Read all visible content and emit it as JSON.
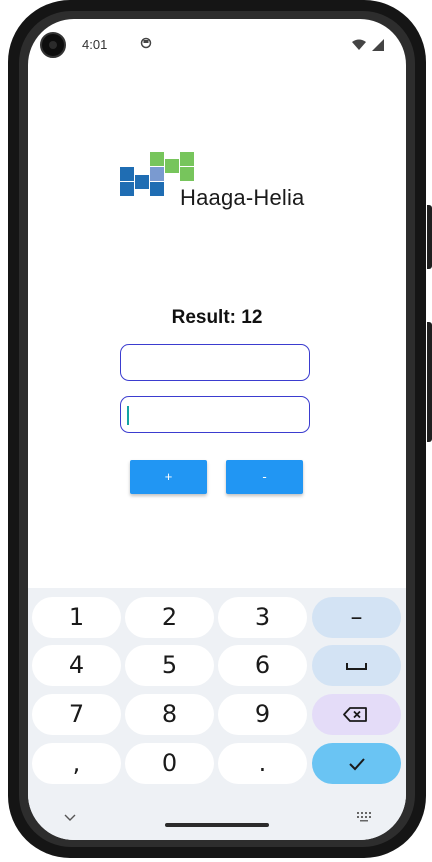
{
  "status_bar": {
    "time": "4:01"
  },
  "logo": {
    "text": "Haaga-Helia"
  },
  "result": {
    "label": "Result: 12"
  },
  "inputs": {
    "first_value": "",
    "second_value": ""
  },
  "buttons": {
    "plus_label": "+",
    "minus_label": "-"
  },
  "keyboard": {
    "row1": [
      "1",
      "2",
      "3"
    ],
    "row2": [
      "4",
      "5",
      "6"
    ],
    "row3": [
      "7",
      "8",
      "9"
    ],
    "row4": [
      ",",
      "0",
      "."
    ],
    "minus_key": "–",
    "space_key_icon": "space-icon",
    "delete_key_icon": "backspace-icon",
    "enter_key_icon": "check-icon"
  },
  "colors": {
    "primary_button": "#2196f3",
    "input_border": "#3b3ccf",
    "enter_key": "#6ac4f3",
    "delete_key": "#e4dcf8",
    "function_key": "#d3e3f4",
    "logo_blue": "#1f6db3",
    "logo_green": "#77c55c"
  }
}
